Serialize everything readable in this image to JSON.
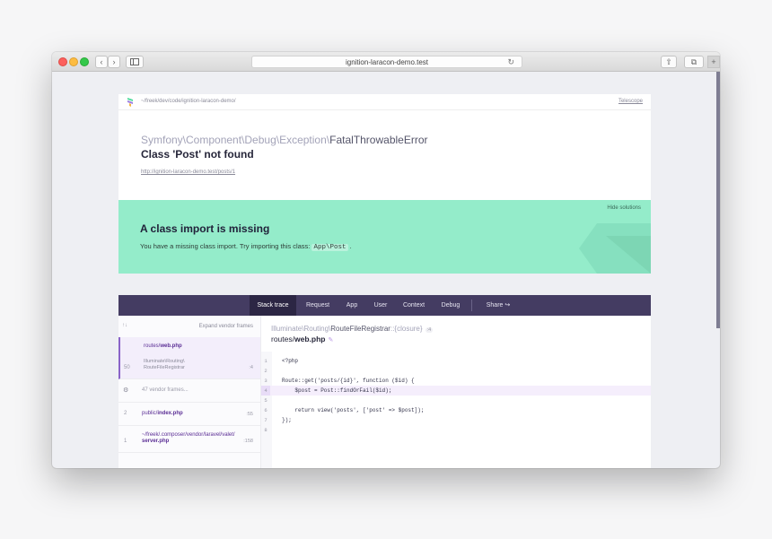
{
  "browser": {
    "url": "ignition-laracon-demo.test",
    "nav_back": "‹",
    "nav_forward": "›",
    "reload_glyph": "↻",
    "share_glyph": "⇧",
    "tabs_glyph": "⧉",
    "new_tab_glyph": "+"
  },
  "header": {
    "app_path": "~/freek/dev/code/ignition-laracon-demo/",
    "telescope_link": "Telescope",
    "exception_namespace": "Symfony\\Component\\Debug\\Exception\\",
    "exception_short": "FatalThrowableError",
    "message": "Class 'Post' not found",
    "request_url": "http://ignition-laracon-demo.test/posts/1"
  },
  "solution": {
    "hide_label": "Hide solutions",
    "title": "A class import is missing",
    "description": "You have a missing class import. Try importing this class:",
    "class_suggestion": "App\\Post",
    "description_end": "."
  },
  "tabs": {
    "items": [
      {
        "label": "Stack trace",
        "active": true
      },
      {
        "label": "Request"
      },
      {
        "label": "App"
      },
      {
        "label": "User"
      },
      {
        "label": "Context"
      },
      {
        "label": "Debug"
      }
    ],
    "share_label": "Share",
    "share_icon": "↪"
  },
  "frames": {
    "arrows": "↑↓",
    "expand_label": "Expand vendor frames",
    "items": [
      {
        "number": "50",
        "file_dir": "routes/",
        "file_name": "web.php",
        "class_line1": "Illuminate\\Routing\\",
        "class_line2": "RouteFileRegistrar",
        "line": ":4",
        "active": true
      },
      {
        "vendor_icon": "⚙",
        "vendor_label": "47 vendor frames..."
      },
      {
        "number": "2",
        "file_dir": "public/",
        "file_name": "index.php",
        "line": ":55"
      },
      {
        "number": "1",
        "file_dir": "~/freek/.composer/vendor/laravel/valet/",
        "file_name": "server.php",
        "line": ":158"
      }
    ]
  },
  "code": {
    "class_namespace": "Illuminate\\Routing\\",
    "class_short": "RouteFileRegistrar",
    "method": "::{closure}",
    "line_badge": ":4",
    "file_dir": "routes/",
    "file_name": "web.php",
    "pencil_icon": "✎",
    "lines": [
      {
        "n": "1",
        "code": "<?php"
      },
      {
        "n": "2",
        "code": ""
      },
      {
        "n": "3",
        "code": "Route::get('posts/{id}', function ($id) {"
      },
      {
        "n": "4",
        "code": "    $post = Post::findOrFail($id);",
        "highlight": true
      },
      {
        "n": "5",
        "code": ""
      },
      {
        "n": "6",
        "code": "    return view('posts', ['post' => $post]);"
      },
      {
        "n": "7",
        "code": "});"
      },
      {
        "n": "8",
        "code": ""
      }
    ]
  },
  "colors": {
    "solution_bg": "#94ecca",
    "tabbar_bg": "#443c62",
    "active_frame_accent": "#8a63c8"
  }
}
